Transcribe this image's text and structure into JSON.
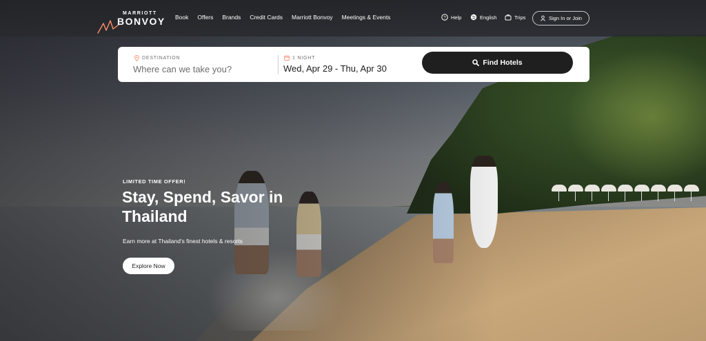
{
  "brand": {
    "logo_small": "MARRIOTT",
    "logo_main": "BONVOY"
  },
  "nav": {
    "items": [
      "Book",
      "Offers",
      "Brands",
      "Credit Cards",
      "Marriott Bonvoy",
      "Meetings & Events"
    ]
  },
  "utility": {
    "help": "Help",
    "language": "English",
    "trips": "Trips",
    "sign_in": "Sign In or Join"
  },
  "search": {
    "destination_label": "DESTINATION",
    "destination_placeholder": "Where can we take you?",
    "nights_label": "1 NIGHT",
    "dates": "Wed, Apr 29 - Thu, Apr 30",
    "button_label": "Find Hotels"
  },
  "promo": {
    "kicker": "LIMITED TIME OFFER!",
    "title": "Stay, Spend, Savor in Thailand",
    "subtitle": "Earn more at Thailand's finest hotels & resorts",
    "cta": "Explore Now"
  },
  "icons": {
    "help": "help-circle-icon",
    "language": "globe-icon",
    "trips": "suitcase-icon",
    "account": "user-icon",
    "destination": "map-pin-icon",
    "calendar": "calendar-icon",
    "search": "search-icon"
  },
  "colors": {
    "accent": "#ff8d6b",
    "button_dark": "#1f1f1f"
  }
}
